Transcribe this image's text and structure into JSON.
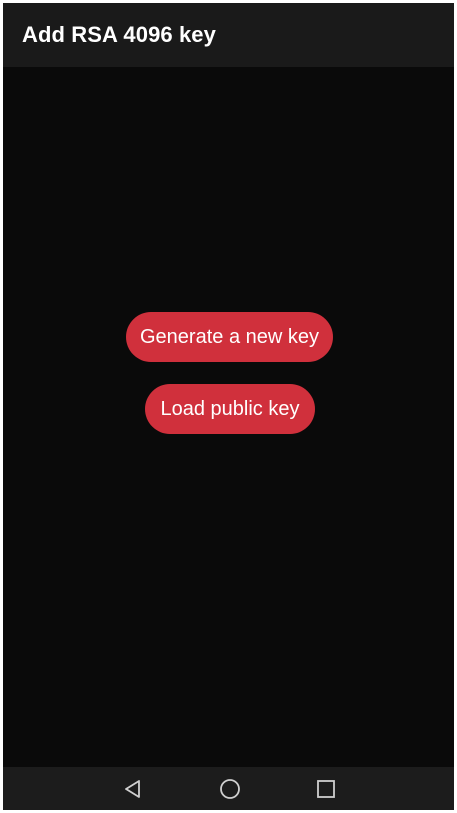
{
  "app_bar": {
    "title": "Add RSA 4096 key"
  },
  "actions": {
    "generate_label": "Generate a new key",
    "load_label": "Load public key"
  },
  "nav_bar": {
    "back_icon": "back-triangle-icon",
    "home_icon": "home-circle-icon",
    "recents_icon": "recents-square-icon"
  },
  "colors": {
    "accent": "#d0303c",
    "background": "#0a0a0a",
    "app_bar": "#1a1a1a",
    "nav_bar": "#1c1c1c",
    "text": "#ffffff",
    "nav_icon": "#cfcfcf"
  }
}
